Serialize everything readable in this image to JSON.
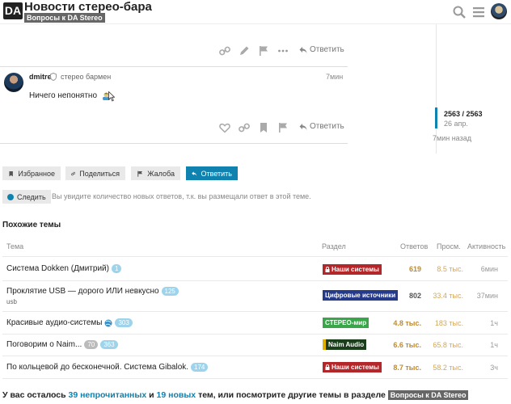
{
  "header": {
    "logo": "DA",
    "title": "Новости стерео-бара",
    "category": "Вопросы к DA Stereo"
  },
  "icons": {
    "search": "search-icon",
    "menu": "hamburger-menu-icon",
    "user": "user-avatar"
  },
  "post_top_actions": {
    "reply_label": "Ответить"
  },
  "post": {
    "username": "dmitre",
    "user_title": "стерео бармен",
    "time": "7мин",
    "body": "Ничего непонятно",
    "reply_label": "Ответить"
  },
  "timeline": {
    "position": "2563 / 2563",
    "date": "26 апр.",
    "ago": "7мин назад"
  },
  "footer_buttons": {
    "bookmark": "Избранное",
    "share": "Поделиться",
    "flag": "Жалоба",
    "reply": "Ответить",
    "follow": "Следить",
    "follow_note": "Вы увидите количество новых ответов, т.к. вы размещали ответ в этой теме."
  },
  "similar": {
    "title": "Похожие темы",
    "columns": {
      "topic": "Тема",
      "category": "Раздел",
      "replies": "Ответов",
      "views": "Просм.",
      "activity": "Активность"
    },
    "rows": [
      {
        "topic": "Система Dokken (Дмитрий)",
        "pill": "1",
        "category": "Наши системы",
        "replies": "619",
        "views": "8.5 тыс.",
        "activity": "6мин"
      },
      {
        "topic": "Проклятие USB — дорого ИЛИ невкусно",
        "pill": "125",
        "tag": "usb",
        "category": "Цифровые источники",
        "replies": "802",
        "views": "33.4 тыс.",
        "activity": "37мин"
      },
      {
        "topic": "Красивые аудио-системы",
        "pill": "303",
        "category": "СТЕРЕО-мир",
        "replies": "4.8 тыс.",
        "views": "183 тыс.",
        "activity": "1ч"
      },
      {
        "topic": "Поговорим о Naim...",
        "pill_grey": "70",
        "pill": "363",
        "category": "Naim Audio",
        "replies": "6.6 тыс.",
        "views": "65.8 тыс.",
        "activity": "1ч"
      },
      {
        "topic": "По кольцевой до бесконечной. Система Gibalok.",
        "pill": "174",
        "category": "Наши системы",
        "replies": "8.7 тыс.",
        "views": "58.2 тыс.",
        "activity": "3ч"
      }
    ]
  },
  "bottom": {
    "prefix": "У вас осталось",
    "unread": "39 непрочитанных",
    "and": "и",
    "new": "19 новых",
    "suffix": "тем, или посмотрите другие темы в разделе",
    "category": "Вопросы к DA Stereo"
  },
  "colors": {
    "accent": "#0f82af",
    "cat_our_systems": "#b3262a",
    "cat_digital": "#263a8a",
    "cat_stereo_world": "#3aa64a",
    "cat_naim": "#1a3d1a",
    "replies_hot": "#c08a2e"
  }
}
